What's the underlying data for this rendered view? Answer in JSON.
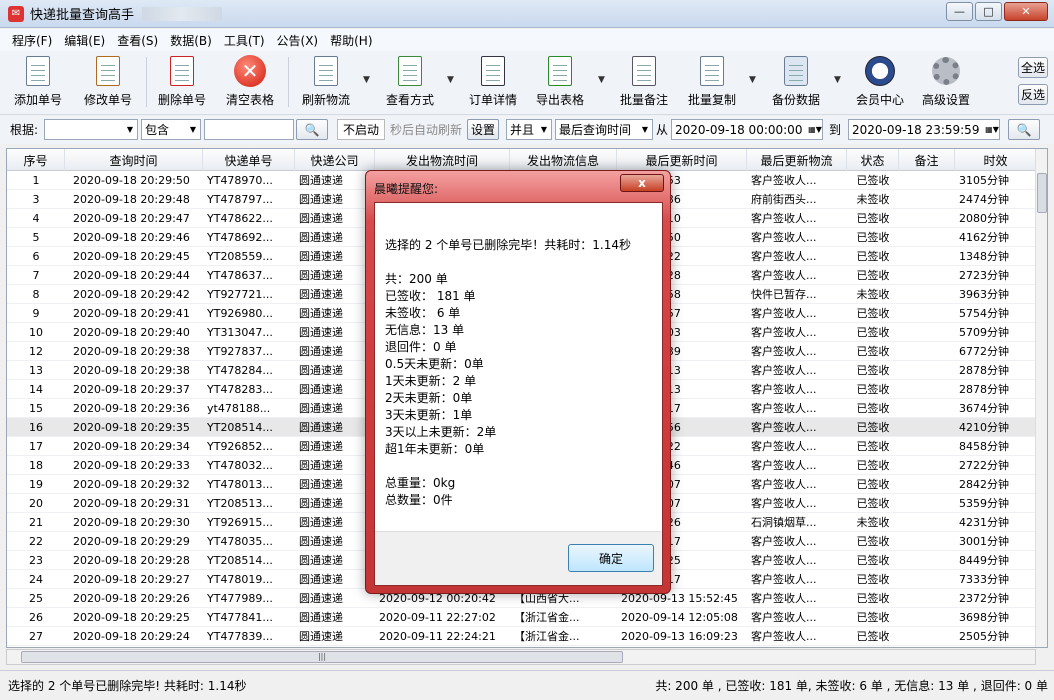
{
  "window": {
    "title": "快递批量查询高手"
  },
  "menu": [
    "程序(F)",
    "编辑(E)",
    "查看(S)",
    "数据(B)",
    "工具(T)",
    "公告(X)",
    "帮助(H)"
  ],
  "toolbar": {
    "buttons": [
      "添加单号",
      "修改单号",
      "删除单号",
      "清空表格",
      "刷新物流",
      "查看方式",
      "订单详情",
      "导出表格",
      "批量备注",
      "批量复制",
      "备份数据",
      "会员中心",
      "高级设置"
    ],
    "select_all": "全选",
    "invert": "反选"
  },
  "filter": {
    "root_label": "根据:",
    "contains": "包含",
    "not_started": "不启动",
    "auto_refresh": "秒后自动刷新",
    "set": "设置",
    "and": "并且",
    "last_query_time": "最后查询时间",
    "from": "从",
    "date_from": "2020-09-18 00:00:00",
    "to": "到",
    "date_to": "2020-09-18 23:59:59"
  },
  "table": {
    "columns": [
      "序号",
      "查询时间",
      "快递单号",
      "快递公司",
      "发出物流时间",
      "发出物流信息",
      "最后更新时间",
      "最后更新物流",
      "状态",
      "备注",
      "时效"
    ],
    "rows": [
      [
        "1",
        "2020-09-18 20:29:50",
        "YT478970...",
        "圆通速递",
        "",
        "",
        "8 18:15:53",
        "客户签收人...",
        "已签收",
        "",
        "3105分钟"
      ],
      [
        "3",
        "2020-09-18 20:29:48",
        "YT478797...",
        "圆通速递",
        "",
        "",
        "7 09:32:36",
        "府前街西头...",
        "未签收",
        "",
        "2474分钟"
      ],
      [
        "4",
        "2020-09-18 20:29:47",
        "YT478622...",
        "圆通速递",
        "",
        "",
        "6 08:43:10",
        "客户签收人...",
        "已签收",
        "",
        "2080分钟"
      ],
      [
        "5",
        "2020-09-18 20:29:46",
        "YT478692...",
        "圆通速递",
        "",
        "",
        "7 17:17:50",
        "客户签收人...",
        "已签收",
        "",
        "4162分钟"
      ],
      [
        "6",
        "2020-09-18 20:29:45",
        "YT208559...",
        "圆通速递",
        "",
        "",
        "5 17:51:22",
        "客户签收人...",
        "已签收",
        "",
        "1348分钟"
      ],
      [
        "7",
        "2020-09-18 20:29:44",
        "YT478637...",
        "圆通速递",
        "",
        "",
        "6 16:14:28",
        "客户签收人...",
        "已签收",
        "",
        "2723分钟"
      ],
      [
        "8",
        "2020-09-18 20:29:42",
        "YT927721...",
        "圆通速递",
        "",
        "",
        "7 12:36:58",
        "快件已暂存...",
        "未签收",
        "",
        "3963分钟"
      ],
      [
        "9",
        "2020-09-18 20:29:41",
        "YT926980...",
        "圆通速递",
        "",
        "",
        "8 18:25:57",
        "客户签收人...",
        "已签收",
        "",
        "5754分钟"
      ],
      [
        "10",
        "2020-09-18 20:29:40",
        "YT313047...",
        "圆通速递",
        "",
        "",
        "6 16:03:03",
        "客户签收人...",
        "已签收",
        "",
        "5709分钟"
      ],
      [
        "12",
        "2020-09-18 20:29:38",
        "YT927837...",
        "圆通速递",
        "",
        "",
        "8 11:32:39",
        "客户签收人...",
        "已签收",
        "",
        "6772分钟"
      ],
      [
        "13",
        "2020-09-18 20:29:38",
        "YT478284...",
        "圆通速递",
        "",
        "",
        "5 09:36:13",
        "客户签收人...",
        "已签收",
        "",
        "2878分钟"
      ],
      [
        "14",
        "2020-09-18 20:29:37",
        "YT478283...",
        "圆通速递",
        "",
        "",
        "5 09:36:13",
        "客户签收人...",
        "已签收",
        "",
        "2878分钟"
      ],
      [
        "15",
        "2020-09-18 20:29:36",
        "yt478188...",
        "圆通速递",
        "",
        "",
        "5 10:46:17",
        "客户签收人...",
        "已签收",
        "",
        "3674分钟"
      ],
      [
        "16",
        "2020-09-18 20:29:35",
        "YT208514...",
        "圆通速递",
        "",
        "",
        "5 17:18:56",
        "客户签收人...",
        "已签收",
        "",
        "4210分钟"
      ],
      [
        "17",
        "2020-09-18 20:29:34",
        "YT926852...",
        "圆通速递",
        "",
        "",
        "8 15:42:22",
        "客户签收人...",
        "已签收",
        "",
        "8458分钟"
      ],
      [
        "18",
        "2020-09-18 20:29:33",
        "YT478032...",
        "圆通速递",
        "",
        "",
        "4 16:02:46",
        "客户签收人...",
        "已签收",
        "",
        "2722分钟"
      ],
      [
        "19",
        "2020-09-18 20:29:32",
        "YT478013...",
        "圆通速递",
        "",
        "",
        "4 17:08:07",
        "客户签收人...",
        "已签收",
        "",
        "2842分钟"
      ],
      [
        "20",
        "2020-09-18 20:29:31",
        "YT208513...",
        "圆通速递",
        "",
        "",
        "5 10:57:07",
        "客户签收人...",
        "已签收",
        "",
        "5359分钟"
      ],
      [
        "21",
        "2020-09-18 20:29:30",
        "YT926915...",
        "圆通速递",
        "",
        "",
        "5 15:55:26",
        "石洞镇烟草...",
        "未签收",
        "",
        "4231分钟"
      ],
      [
        "22",
        "2020-09-18 20:29:29",
        "YT478035...",
        "圆通速递",
        "",
        "",
        "4 19:24:17",
        "客户签收人...",
        "已签收",
        "",
        "3001分钟"
      ],
      [
        "23",
        "2020-09-18 20:29:28",
        "YT208514...",
        "圆通速递",
        "",
        "",
        "8 14:10:25",
        "客户签收人...",
        "已签收",
        "",
        "8449分钟"
      ],
      [
        "24",
        "2020-09-18 20:29:27",
        "YT478019...",
        "圆通速递",
        "",
        "",
        "7 18:27:17",
        "客户签收人...",
        "已签收",
        "",
        "7333分钟"
      ],
      [
        "25",
        "2020-09-18 20:29:26",
        "YT477989...",
        "圆通速递",
        "2020-09-12 00:20:42",
        "【山西省大...",
        "2020-09-13 15:52:45",
        "客户签收人...",
        "已签收",
        "",
        "2372分钟"
      ],
      [
        "26",
        "2020-09-18 20:29:25",
        "YT477841...",
        "圆通速递",
        "2020-09-11 22:27:02",
        "【浙江省金...",
        "2020-09-14 12:05:08",
        "客户签收人...",
        "已签收",
        "",
        "3698分钟"
      ],
      [
        "27",
        "2020-09-18 20:29:24",
        "YT477839...",
        "圆通速递",
        "2020-09-11 22:24:21",
        "【浙江省金...",
        "2020-09-13 16:09:23",
        "客户签收人...",
        "已签收",
        "",
        "2505分钟"
      ]
    ]
  },
  "status": {
    "left": "选择的 2 个单号已删除完毕! 共耗时: 1.14秒",
    "right": "共: 200 单 , 已签收: 181 单, 未签收: 6 单 , 无信息: 13 单 , 退回件: 0 单"
  },
  "dialog": {
    "title": "晨曦提醒您:",
    "close": "x",
    "lines": [
      "选择的 2 个单号已删除完毕！共耗时：1.14秒",
      "",
      "共：200 单",
      "已签收： 181 单",
      "未签收： 6 单",
      "无信息：13 单",
      "退回件：0 单",
      " 0.5天未更新：0单",
      "1天未更新：2 单",
      "2天未更新：0单",
      "3天未更新：1单",
      "3天以上未更新：2单",
      "超1年未更新：0单",
      "",
      "总重量：0kg",
      "总数量：0件"
    ],
    "ok": "确定"
  }
}
